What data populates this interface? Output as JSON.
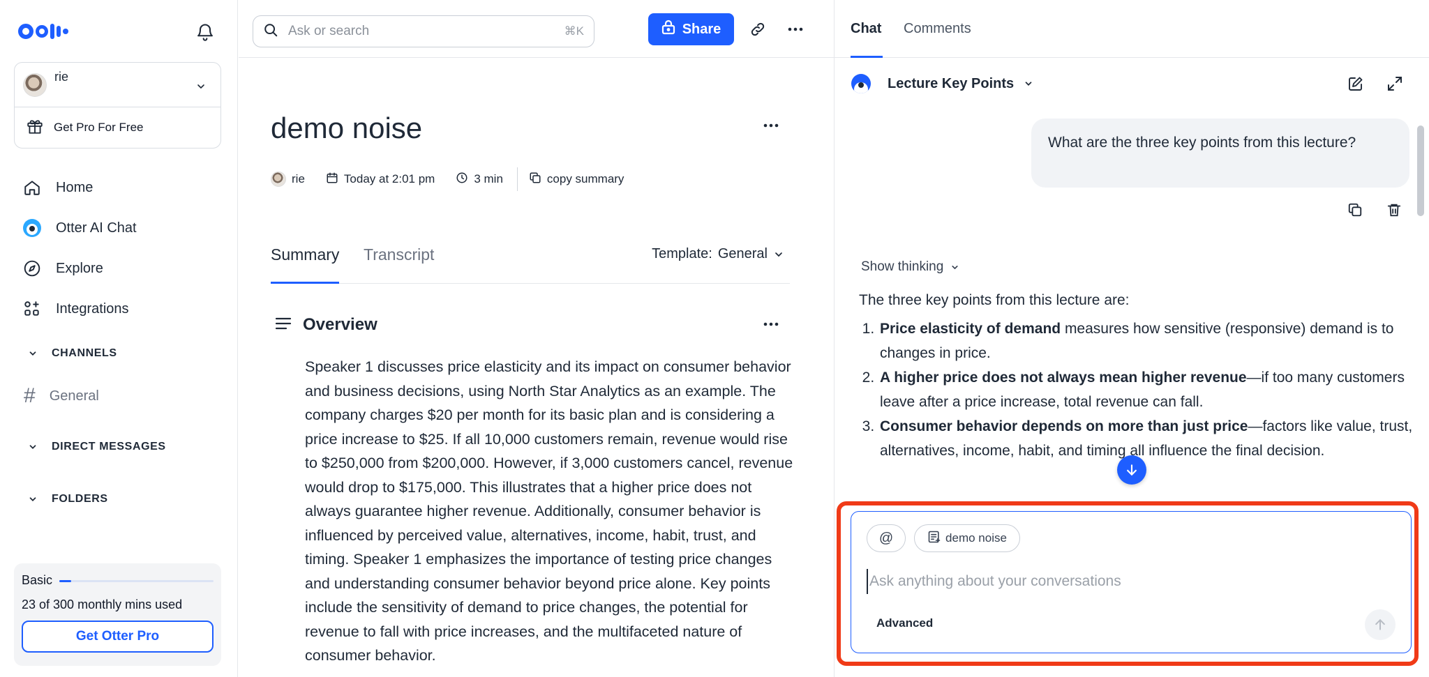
{
  "sidebar": {
    "user": {
      "name": "rie"
    },
    "get_pro_label": "Get Pro For Free",
    "nav": [
      {
        "label": "Home",
        "icon": "home-icon"
      },
      {
        "label": "Otter AI Chat",
        "icon": "otter-chat-icon"
      },
      {
        "label": "Explore",
        "icon": "compass-icon"
      },
      {
        "label": "Integrations",
        "icon": "integrations-icon"
      }
    ],
    "sections": {
      "channels": "CHANNELS",
      "channel_general": "General",
      "direct_messages": "DIRECT MESSAGES",
      "folders": "FOLDERS"
    },
    "plan": {
      "name": "Basic",
      "usage_text": "23 of 300 monthly mins used",
      "usage_fraction": 0.077,
      "upgrade_label": "Get Otter Pro"
    }
  },
  "header": {
    "search_placeholder": "Ask or search",
    "search_shortcut": "⌘K",
    "share_label": "Share"
  },
  "document": {
    "title": "demo noise",
    "meta": {
      "author": "rie",
      "date": "Today at 2:01 pm",
      "duration": "3 min",
      "copy_summary": "copy summary"
    },
    "tabs": [
      "Summary",
      "Transcript"
    ],
    "template_label": "Template:",
    "template_value": "General",
    "overview_title": "Overview",
    "overview_text": "Speaker 1 discusses price elasticity and its impact on consumer behavior and business decisions, using North Star Analytics as an example. The company charges $20 per month for its basic plan and is considering a price increase to $25. If all 10,000 customers remain, revenue would rise to $250,000 from $200,000. However, if 3,000 customers cancel, revenue would drop to $175,000. This illustrates that a higher price does not always guarantee higher revenue. Additionally, consumer behavior is influenced by perceived value, alternatives, income, habit, trust, and timing. Speaker 1 emphasizes the importance of testing price changes and understanding consumer behavior beyond price alone. Key points include the sensitivity of demand to price changes, the potential for revenue to fall with price increases, and the multifaceted nature of consumer behavior."
  },
  "chat": {
    "tabs": {
      "chat": "Chat",
      "comments": "Comments"
    },
    "conversation_title": "Lecture Key Points",
    "user_message": "What are the three key points from this lecture?",
    "show_thinking": "Show thinking",
    "answer_intro": "The three key points from this lecture are:",
    "answer_points": [
      {
        "bold": "Price elasticity of demand",
        "rest": " measures how sensitive (responsive) demand is to changes in price."
      },
      {
        "bold": "A higher price does not always mean higher revenue",
        "rest": "—if too many customers leave after a price increase, total revenue can fall."
      },
      {
        "bold": "Consumer behavior depends on more than just price",
        "rest": "—factors like value, trust, alternatives, income, habit, and timing all influence the final decision."
      }
    ],
    "composer": {
      "mention_chip": "@",
      "context_chip": "demo noise",
      "placeholder": "Ask anything about your conversations",
      "advanced_label": "Advanced"
    },
    "colors": {
      "accent": "#1e5eff",
      "highlight": "#f03a17"
    }
  }
}
